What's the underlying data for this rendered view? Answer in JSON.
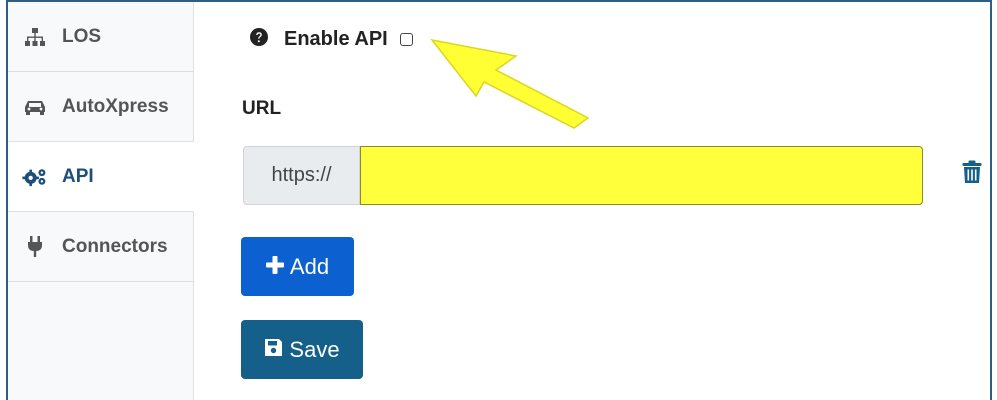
{
  "sidebar": {
    "items": [
      {
        "label": "LOS",
        "icon": "sitemap-icon",
        "active": false
      },
      {
        "label": "AutoXpress",
        "icon": "car-icon",
        "active": false
      },
      {
        "label": "API",
        "icon": "cogs-icon",
        "active": true
      },
      {
        "label": "Connectors",
        "icon": "plug-icon",
        "active": false
      }
    ]
  },
  "main": {
    "enable_api_label": "Enable API",
    "enable_api_checked": false,
    "url_label": "URL",
    "url_prefix": "https://",
    "url_value": "",
    "add_label": "Add",
    "save_label": "Save"
  },
  "colors": {
    "active_text": "#1d4f7a",
    "add_button": "#0c60d0",
    "save_button": "#15608a",
    "highlight": "#ffff3b",
    "trash_icon": "#15608a"
  }
}
